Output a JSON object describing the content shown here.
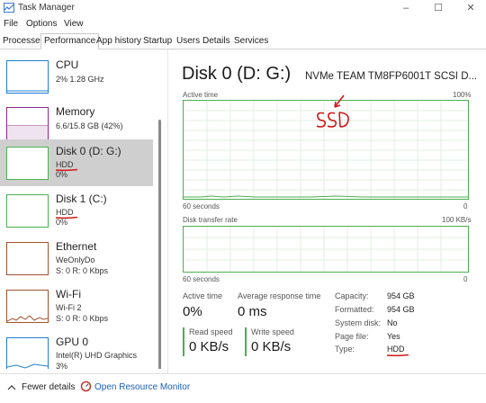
{
  "window": {
    "title": "Task Manager",
    "minimize": "–",
    "maximize": "☐",
    "close": "✕"
  },
  "menu": [
    "File",
    "Options",
    "View"
  ],
  "tabs": [
    "Processes",
    "Performance",
    "App history",
    "Startup",
    "Users",
    "Details",
    "Services"
  ],
  "sidebar": [
    {
      "name": "CPU",
      "sub1": "2% 1.28 GHz"
    },
    {
      "name": "Memory",
      "sub1": "6.6/15.8 GB (42%)"
    },
    {
      "name": "Disk 0 (D: G:)",
      "sub1": "HDD",
      "sub2": "0%"
    },
    {
      "name": "Disk 1 (C:)",
      "sub1": "HDD",
      "sub2": "0%"
    },
    {
      "name": "Ethernet",
      "sub1": "WeOnlyDo",
      "sub2": "S: 0 R: 0 Kbps"
    },
    {
      "name": "Wi-Fi",
      "sub1": "Wi-Fi 2",
      "sub2": "S: 0 R: 0 Kbps"
    },
    {
      "name": "GPU 0",
      "sub1": "Intel(R) UHD Graphics",
      "sub2": "3%"
    }
  ],
  "detail": {
    "title": "Disk 0 (D: G:)",
    "model": "NVMe TEAM TM8FP6001T SCSI D...",
    "graph1": {
      "label": "Active time",
      "max": "100%",
      "time": "60 seconds",
      "min": "0"
    },
    "graph2": {
      "label": "Disk transfer rate",
      "max": "100 KB/s",
      "time": "60 seconds",
      "min": "0"
    },
    "active_time": {
      "label": "Active time",
      "value": "0%"
    },
    "avg_response": {
      "label": "Average response time",
      "value": "0 ms"
    },
    "read_speed": {
      "label": "Read speed",
      "value": "0 KB/s"
    },
    "write_speed": {
      "label": "Write speed",
      "value": "0 KB/s"
    },
    "properties": [
      {
        "label": "Capacity:",
        "value": "954 GB"
      },
      {
        "label": "Formatted:",
        "value": "954 GB"
      },
      {
        "label": "System disk:",
        "value": "No"
      },
      {
        "label": "Page file:",
        "value": "Yes"
      },
      {
        "label": "Type:",
        "value": "HDD"
      }
    ]
  },
  "annotation": {
    "text": "SSD",
    "color": "#d01818"
  },
  "footer": {
    "fewer_details": "Fewer details",
    "resource_monitor": "Open Resource Monitor"
  },
  "colors": {
    "cpu": "#1f7fd0",
    "memory": "#8b2a8b",
    "disk": "#4caf50",
    "network": "#a0522d",
    "gpu": "#1f7fd0",
    "link": "#1a5fb4"
  }
}
